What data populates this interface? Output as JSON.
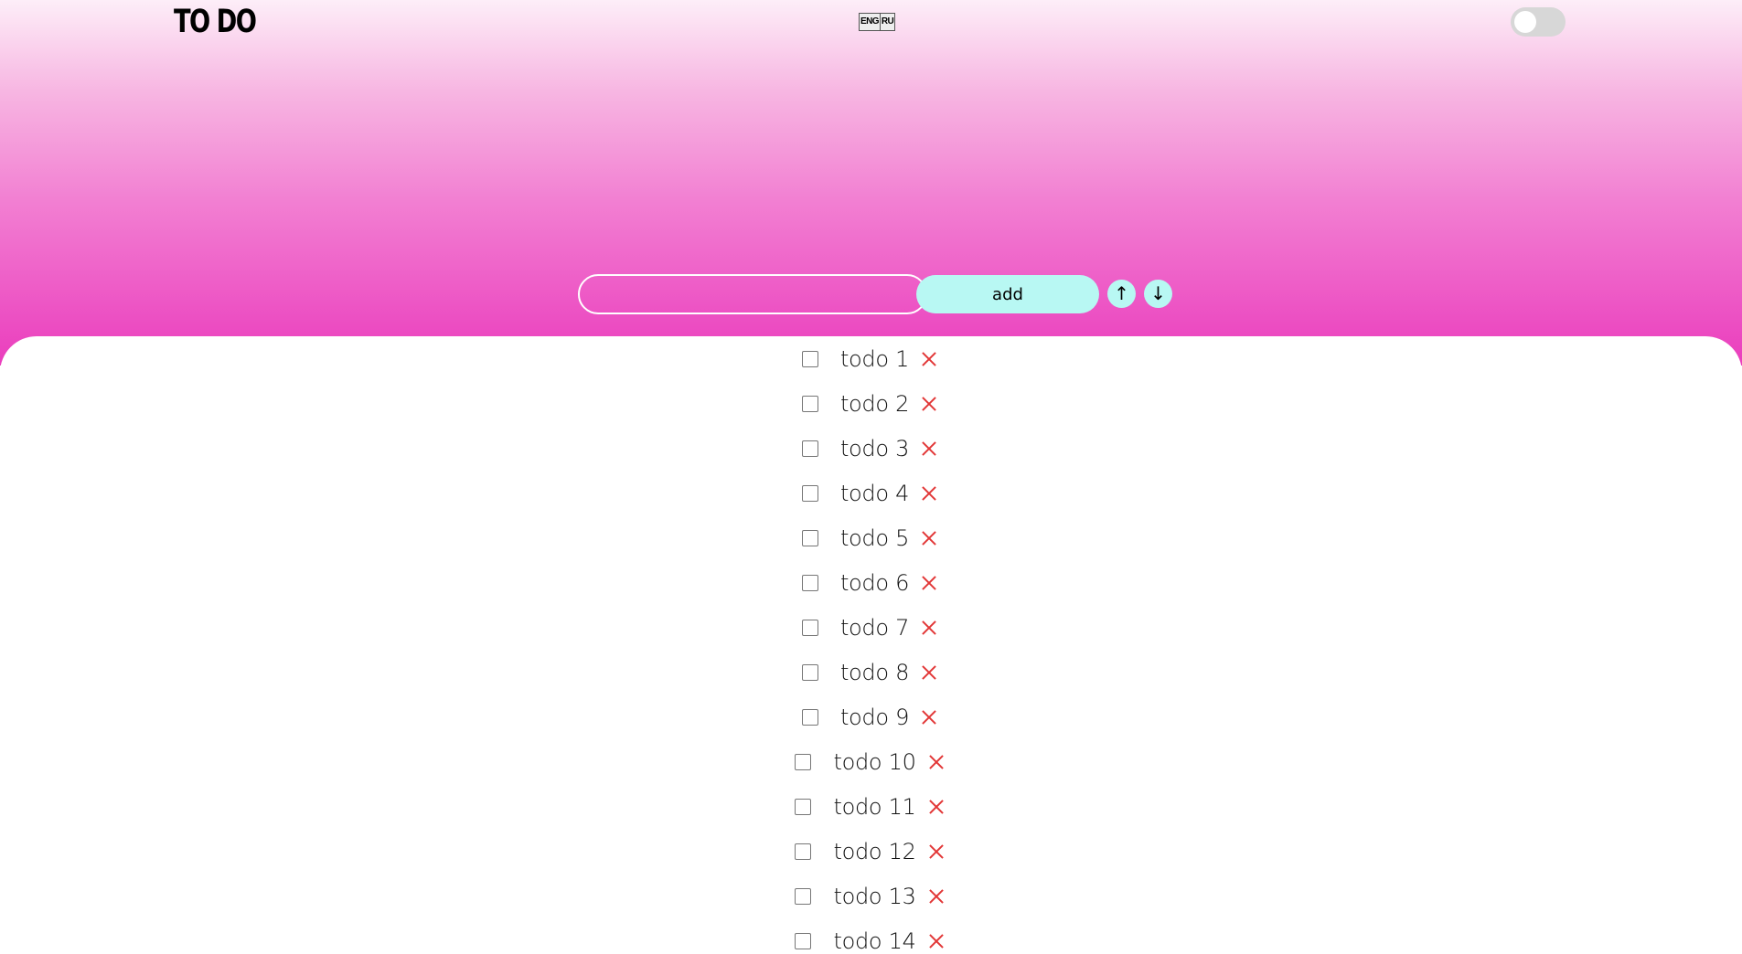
{
  "header": {
    "logo": "TO DO",
    "languages": [
      "ENG",
      "RU"
    ],
    "theme_toggle_on": false
  },
  "form": {
    "input_value": "",
    "add_label": "add",
    "sort_up": "↑",
    "sort_down": "↓"
  },
  "todos": [
    {
      "text": "todo 1",
      "done": false
    },
    {
      "text": "todo 2",
      "done": false
    },
    {
      "text": "todo 3",
      "done": false
    },
    {
      "text": "todo 4",
      "done": false
    },
    {
      "text": "todo 5",
      "done": false
    },
    {
      "text": "todo 6",
      "done": false
    },
    {
      "text": "todo 7",
      "done": false
    },
    {
      "text": "todo 8",
      "done": false
    },
    {
      "text": "todo 9",
      "done": false
    },
    {
      "text": "todo 10",
      "done": false
    },
    {
      "text": "todo 11",
      "done": false
    },
    {
      "text": "todo 12",
      "done": false
    },
    {
      "text": "todo 13",
      "done": false
    },
    {
      "text": "todo 14",
      "done": false
    }
  ],
  "colors": {
    "gradient_top": "#fdeef8",
    "gradient_bottom": "#ea3dbd",
    "button": "#b8f8f3",
    "delete": "#e23636"
  }
}
